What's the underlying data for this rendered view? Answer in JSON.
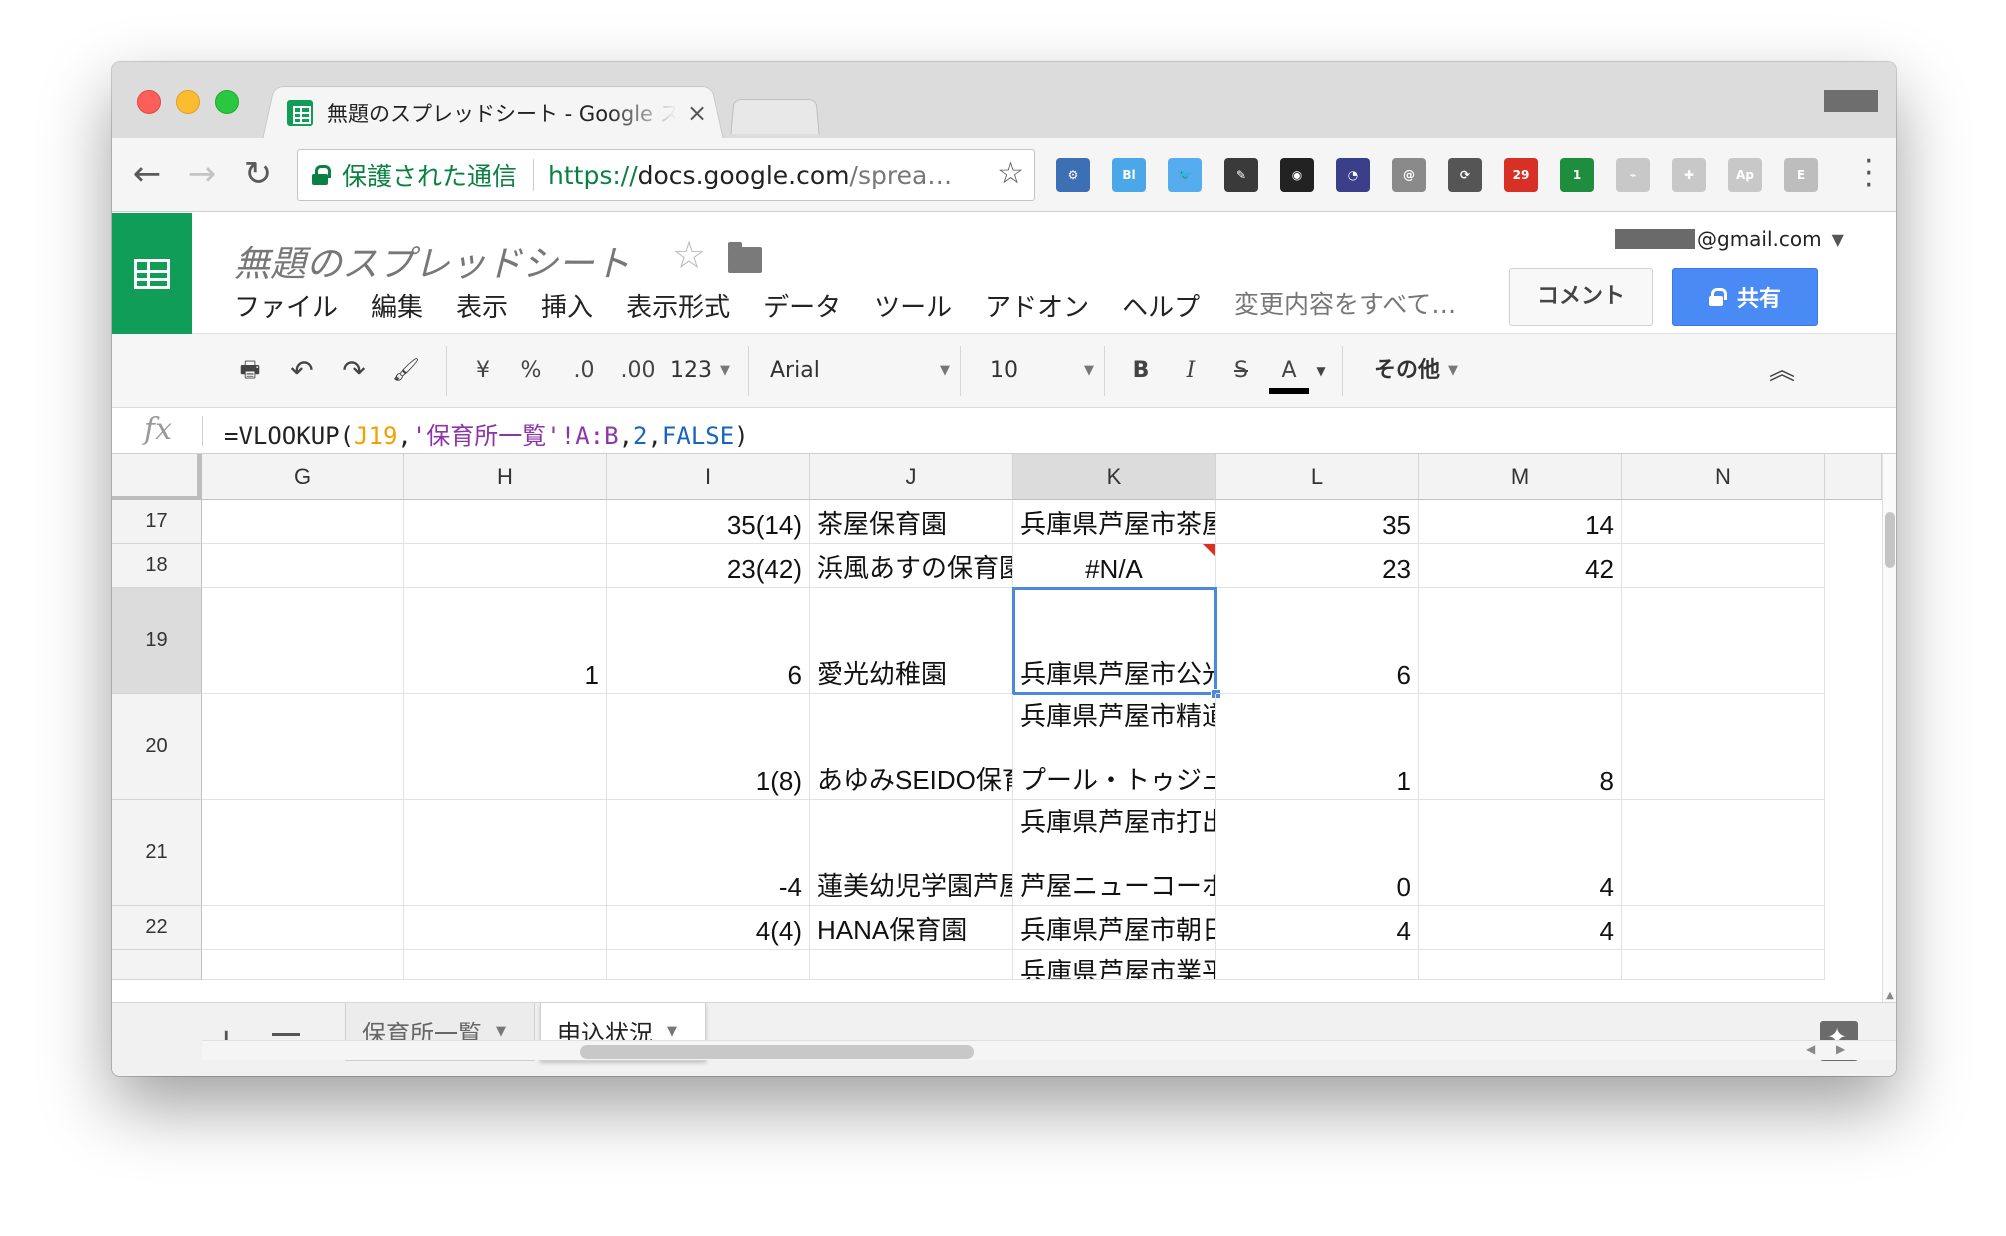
{
  "browser": {
    "tab_title": "無題のスプレッドシート - Google スプレッドシート",
    "tab_close": "×",
    "secure_label": "保護された通信",
    "url_scheme": "https://",
    "url_host": "docs.google.com",
    "url_path": "/sprea…",
    "extensions": [
      {
        "name": "gear-extension-icon",
        "color": "#3d6fb5",
        "label": "⚙"
      },
      {
        "name": "bl-extension-icon",
        "color": "#4aa8e8",
        "label": "Bl"
      },
      {
        "name": "twitter-extension-icon",
        "color": "#55acee",
        "label": "🐦"
      },
      {
        "name": "eyedropper-extension-icon",
        "color": "#3a3a3a",
        "label": "✎"
      },
      {
        "name": "color-wheel-extension-icon",
        "color": "#222222",
        "label": "◉"
      },
      {
        "name": "speedometer-extension-icon",
        "color": "#3b3f8a",
        "label": "◔"
      },
      {
        "name": "page-capture-extension-icon",
        "color": "#8a8a8a",
        "label": "@"
      },
      {
        "name": "sync-extension-icon",
        "color": "#555555",
        "label": "⟳"
      },
      {
        "name": "calendar-extension-icon",
        "color": "#d93025",
        "label": "29"
      },
      {
        "name": "inbox-extension-icon",
        "color": "#1e8e3e",
        "label": "1"
      },
      {
        "name": "rss-extension-icon",
        "color": "#c8c8c8",
        "label": "⌁"
      },
      {
        "name": "puzzle-extension-icon",
        "color": "#c8c8c8",
        "label": "✚"
      },
      {
        "name": "ap-extension-icon",
        "color": "#c8c8c8",
        "label": "Ap"
      },
      {
        "name": "e-extension-icon",
        "color": "#bdbdbd",
        "label": "E"
      }
    ]
  },
  "app": {
    "doc_title": "無題のスプレッドシート",
    "menu": [
      "ファイル",
      "編集",
      "表示",
      "挿入",
      "表示形式",
      "データ",
      "ツール",
      "アドオン",
      "ヘルプ"
    ],
    "save_status": "変更内容をすべて…",
    "account_suffix": "@gmail.com",
    "comment_label": "コメント",
    "share_label": "共有"
  },
  "toolbar": {
    "currency": "¥",
    "percent": "%",
    "dec_decrease": ".0",
    "dec_increase": ".00",
    "more_formats": "123",
    "font": "Arial",
    "font_size": "10",
    "bold": "B",
    "italic": "I",
    "strike": "S",
    "text_color": "A",
    "more": "その他",
    "text_color_value": "#000000"
  },
  "formula": {
    "fx": "fx",
    "p1": "=VLOOKUP(",
    "ref": "J19",
    "comma1": ",",
    "sheet": "'保育所一覧'",
    "range": "!A:B",
    "comma2": ",",
    "num": "2",
    "comma3": ",",
    "bool": "FALSE",
    "close": ")"
  },
  "grid": {
    "columns": [
      "G",
      "H",
      "I",
      "J",
      "K",
      "L",
      "M",
      "N"
    ],
    "selected_column": "K",
    "selected_row": "19",
    "rows": [
      {
        "num": "17",
        "cells": {
          "I": [
            "35(14)"
          ],
          "J": [
            "茶屋保育園"
          ],
          "K": [
            "兵庫県芦屋市茶屋"
          ],
          "L": [
            "35"
          ],
          "M": [
            "14"
          ]
        }
      },
      {
        "num": "18",
        "cells": {
          "I": [
            "23(42)"
          ],
          "J": [
            "浜風あすの保育園"
          ],
          "K": [
            "#N/A"
          ],
          "L": [
            "23"
          ],
          "M": [
            "42"
          ]
        }
      },
      {
        "num": "19",
        "cells": {
          "H": [
            "1"
          ],
          "I": [
            "6"
          ],
          "J": [
            "愛光幼稚園"
          ],
          "K": [
            "兵庫県芦屋市公光"
          ],
          "L": [
            "6"
          ]
        }
      },
      {
        "num": "20",
        "cells": {
          "I": [
            "1(8)"
          ],
          "J": [
            "あゆみSEIDO保育園"
          ],
          "K": [
            "兵庫県芦屋市精道",
            "プール・トゥジュール"
          ],
          "L": [
            "1"
          ],
          "M": [
            "8"
          ]
        }
      },
      {
        "num": "21",
        "cells": {
          "I": [
            "-4"
          ],
          "J": [
            "蓮美幼児学園芦屋"
          ],
          "K": [
            "兵庫県芦屋市打出",
            "芦屋ニューコーポ"
          ],
          "L": [
            "0"
          ],
          "M": [
            "4"
          ]
        }
      },
      {
        "num": "22",
        "cells": {
          "I": [
            "4(4)"
          ],
          "J": [
            "HANA保育園"
          ],
          "K": [
            "兵庫県芦屋市朝日"
          ],
          "L": [
            "4"
          ],
          "M": [
            "4"
          ]
        }
      },
      {
        "num": "",
        "cells": {
          "K": [
            "兵庫県芦屋市業平"
          ]
        }
      }
    ]
  },
  "sheets": {
    "add": "+",
    "tabs": [
      {
        "label": "保育所一覧",
        "active": false
      },
      {
        "label": "申込状況",
        "active": true
      }
    ]
  }
}
